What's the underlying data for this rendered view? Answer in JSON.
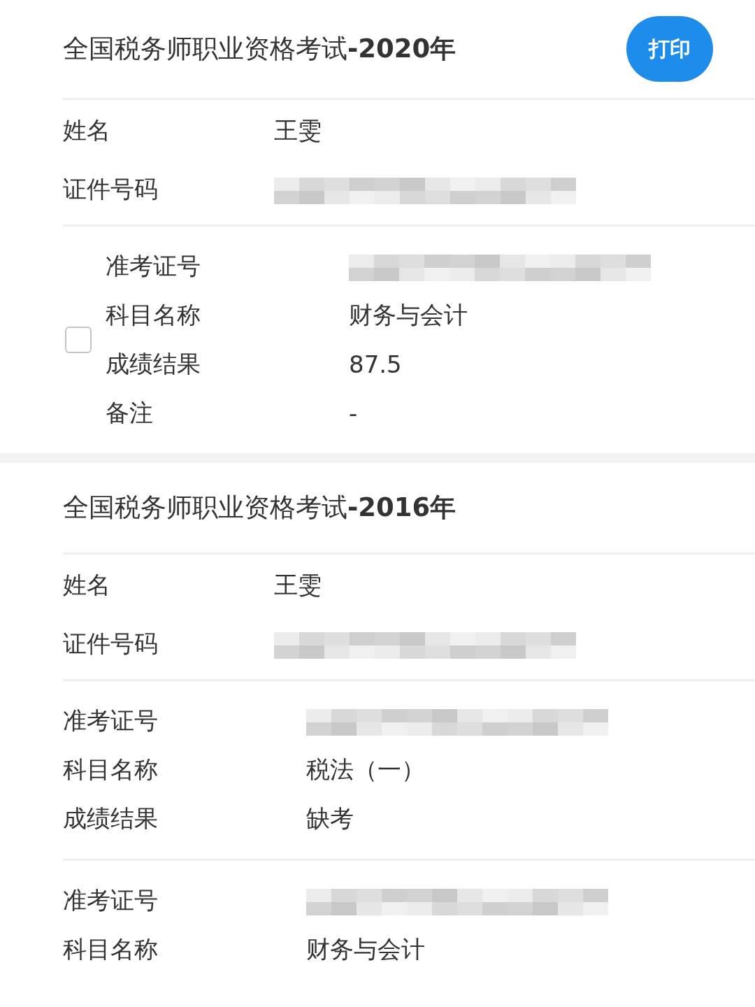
{
  "sections": [
    {
      "title": "全国税务师职业资格考试**-2020年**",
      "print_button": "打印",
      "info": [
        {
          "label": "姓名",
          "value": "王雯"
        },
        {
          "label": "证件号码",
          "redacted": true
        }
      ],
      "subjects": [
        {
          "checked": false,
          "rows": [
            {
              "label": "准考证号",
              "redacted": true
            },
            {
              "label": "科目名称",
              "value": "财务与会计"
            },
            {
              "label": "成绩结果",
              "value": "87.5"
            },
            {
              "label": "备注",
              "value": "-"
            }
          ]
        }
      ]
    },
    {
      "title": "全国税务师职业资格考试**-2016年**",
      "info": [
        {
          "label": "姓名",
          "value": "王雯"
        },
        {
          "label": "证件号码",
          "redacted": true
        }
      ],
      "subjects": [
        {
          "rows": [
            {
              "label": "准考证号",
              "redacted": true
            },
            {
              "label": "科目名称",
              "value": "税法（一）"
            },
            {
              "label": "成绩结果",
              "value": "缺考"
            }
          ]
        },
        {
          "rows": [
            {
              "label": "准考证号",
              "redacted": true
            },
            {
              "label": "科目名称",
              "value": "财务与会计"
            }
          ]
        }
      ]
    }
  ]
}
